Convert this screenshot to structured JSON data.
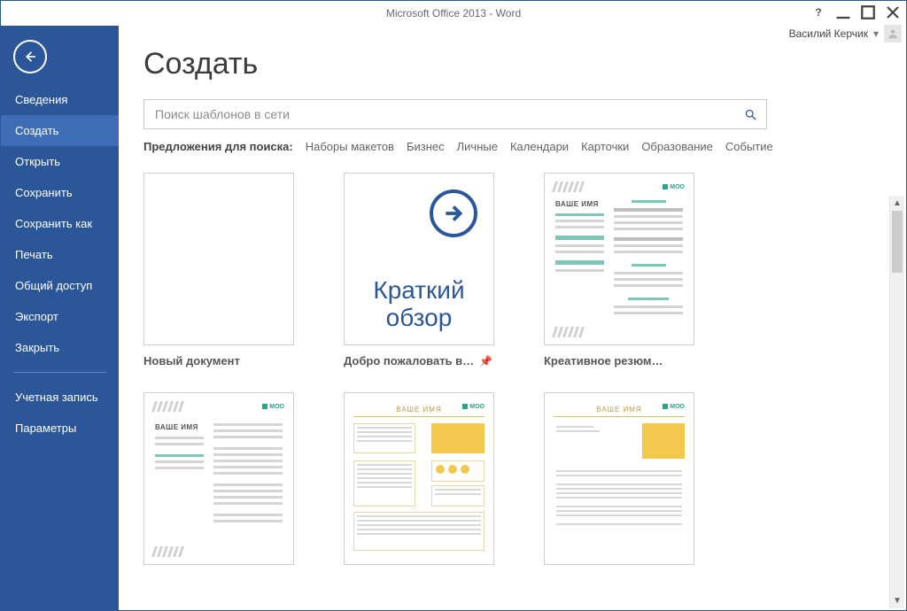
{
  "title": "Microsoft Office 2013 - Word",
  "account": {
    "name": "Василий Керчик"
  },
  "sidebar": {
    "items": [
      {
        "label": "Сведения"
      },
      {
        "label": "Создать"
      },
      {
        "label": "Открыть"
      },
      {
        "label": "Сохранить"
      },
      {
        "label": "Сохранить как"
      },
      {
        "label": "Печать"
      },
      {
        "label": "Общий доступ"
      },
      {
        "label": "Экспорт"
      },
      {
        "label": "Закрыть"
      }
    ],
    "secondary": [
      {
        "label": "Учетная запись"
      },
      {
        "label": "Параметры"
      }
    ]
  },
  "main": {
    "heading": "Создать",
    "search_placeholder": "Поиск шаблонов в сети",
    "suggestions_label": "Предложения для поиска:",
    "suggestions": [
      "Наборы макетов",
      "Бизнес",
      "Личные",
      "Календари",
      "Карточки",
      "Образование",
      "Событие"
    ]
  },
  "templates": [
    {
      "label": "Новый документ"
    },
    {
      "label": "Добро пожаловать в…",
      "tour_line1": "Краткий",
      "tour_line2": "обзор",
      "pinned": false
    },
    {
      "label": "Креативное резюм…",
      "name_text": "ВАШЕ ИМЯ"
    },
    {
      "label": "",
      "name_text": "ВАШЕ ИМЯ"
    },
    {
      "label": "",
      "name_text": "ВАШЕ ИМЯ"
    },
    {
      "label": "",
      "name_text": "ВАШЕ ИМЯ"
    }
  ],
  "moo_brand": "MOO"
}
